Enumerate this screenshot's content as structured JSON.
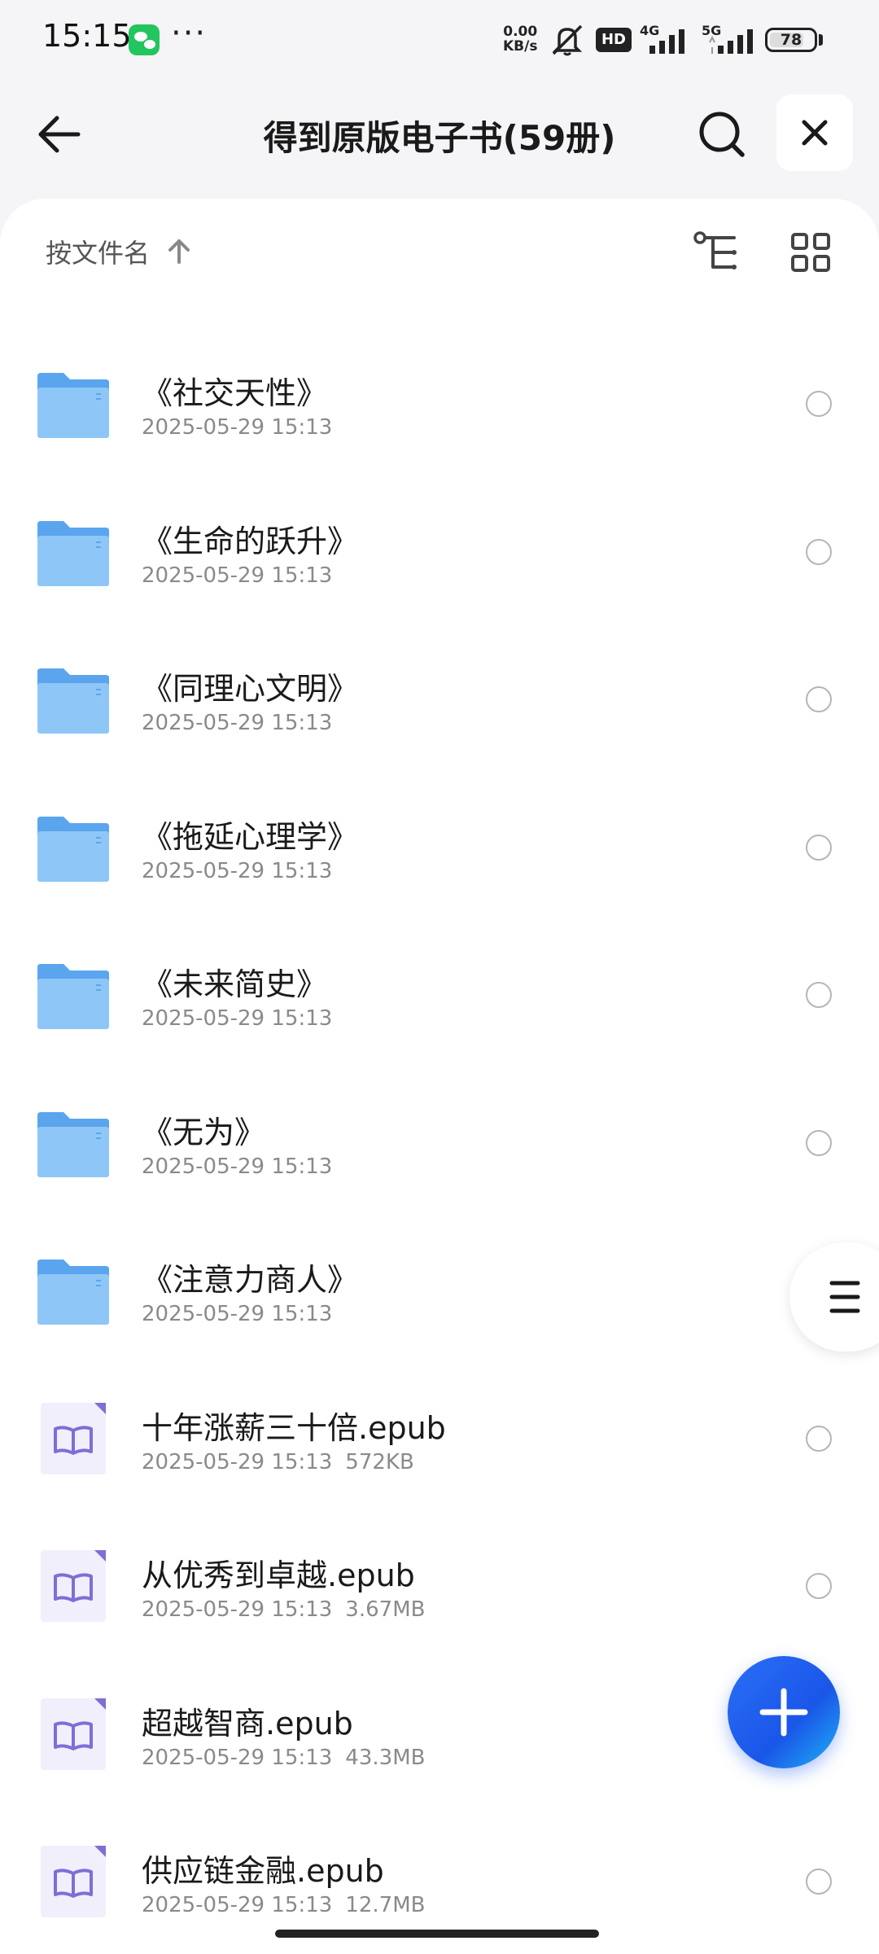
{
  "status_bar": {
    "time": "15:15",
    "net_speed_value": "0.00",
    "net_speed_unit": "KB/s",
    "hd_label": "HD",
    "sig1_label": "4G",
    "sig2_label": "5G",
    "battery": "78",
    "battery_level": 0.78
  },
  "header": {
    "title": "得到原版电子书(59册)"
  },
  "sort_bar": {
    "label": "按文件名"
  },
  "files": [
    {
      "name": "《社交天性》",
      "date": "2025-05-29 15:13",
      "size": "",
      "type": "folder"
    },
    {
      "name": "《生命的跃升》",
      "date": "2025-05-29 15:13",
      "size": "",
      "type": "folder"
    },
    {
      "name": "《同理心文明》",
      "date": "2025-05-29 15:13",
      "size": "",
      "type": "folder"
    },
    {
      "name": "《拖延心理学》",
      "date": "2025-05-29 15:13",
      "size": "",
      "type": "folder"
    },
    {
      "name": "《未来简史》",
      "date": "2025-05-29 15:13",
      "size": "",
      "type": "folder"
    },
    {
      "name": "《无为》",
      "date": "2025-05-29 15:13",
      "size": "",
      "type": "folder"
    },
    {
      "name": "《注意力商人》",
      "date": "2025-05-29 15:13",
      "size": "",
      "type": "folder"
    },
    {
      "name": "十年涨薪三十倍.epub",
      "date": "2025-05-29 15:13",
      "size": "572KB",
      "type": "epub"
    },
    {
      "name": "从优秀到卓越.epub",
      "date": "2025-05-29 15:13",
      "size": "3.67MB",
      "type": "epub"
    },
    {
      "name": "超越智商.epub",
      "date": "2025-05-29 15:13",
      "size": "43.3MB",
      "type": "epub"
    },
    {
      "name": "供应链金融.epub",
      "date": "2025-05-29 15:13",
      "size": "12.7MB",
      "type": "epub"
    }
  ],
  "colors": {
    "accent": "#1a56e8",
    "folder": "#6db3f2",
    "epub_icon": "#7c6fd6"
  },
  "icons": {
    "back": "arrow-left-icon",
    "search": "search-icon",
    "close": "close-icon",
    "sort": "arrow-up-icon",
    "tree": "tree-view-icon",
    "grid": "grid-view-icon",
    "folder": "folder-icon",
    "epub": "book-icon",
    "menu": "menu-icon",
    "add": "plus-icon"
  }
}
